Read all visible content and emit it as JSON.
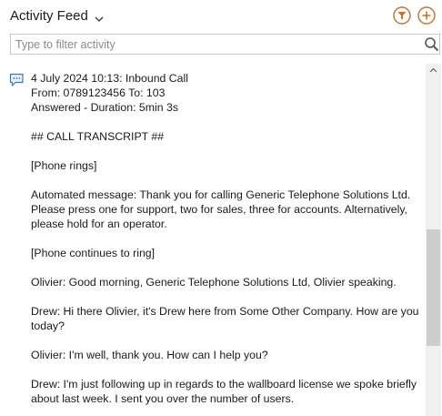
{
  "header": {
    "title": "Activity Feed",
    "dropdown_icon": "chevron-down-icon",
    "filter_icon": "filter-icon",
    "add_icon": "add-circle-icon",
    "accent_color": "#c8702e"
  },
  "filter": {
    "placeholder": "Type to filter activity",
    "value": "",
    "icon": "search-icon"
  },
  "entry": {
    "icon": "chat-bubble-icon",
    "line1": "4 July 2024 10:13: Inbound Call",
    "line2": "From: 0789123456 To: 103",
    "line3": "Answered - Duration: 5min 3s",
    "transcript_heading": "## CALL TRANSCRIPT ##",
    "p1": "[Phone rings]",
    "p2": "Automated message: Thank you for calling Generic Telephone Solutions Ltd. Please press one for support, two for sales, three for accounts. Alternatively, please hold for an operator.",
    "p3": "[Phone continues to ring]",
    "p4": "Olivier: Good morning, Generic Telephone Solutions Ltd, Olivier speaking.",
    "p5": "Drew: Hi there Olivier, it's Drew here from Some Other Company. How are you today?",
    "p6": "Olivier: I'm well, thank you. How can I help you?",
    "p7": "Drew: I'm just following up in regards to the wallboard license we spoke briefly about last week. I sent you over the number of users."
  }
}
